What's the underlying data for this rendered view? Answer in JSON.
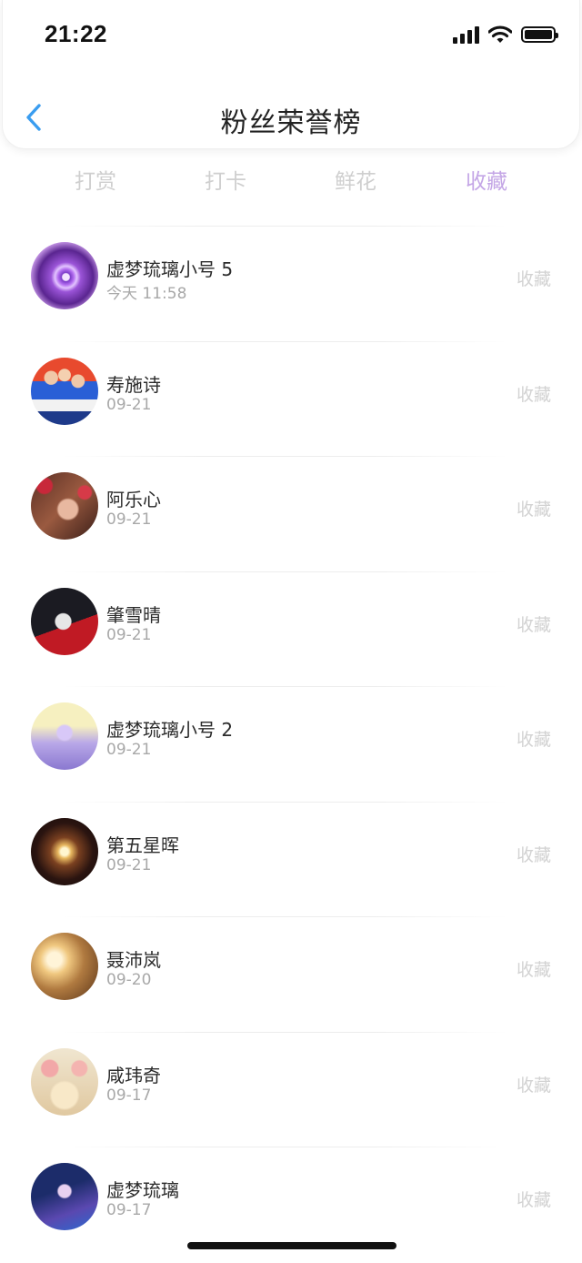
{
  "status": {
    "time": "21:22"
  },
  "header": {
    "title": "粉丝荣誉榜"
  },
  "tabs": [
    {
      "label": "打赏",
      "active": false
    },
    {
      "label": "打卡",
      "active": false
    },
    {
      "label": "鲜花",
      "active": false
    },
    {
      "label": "收藏",
      "active": true
    }
  ],
  "list": [
    {
      "name": "虚梦琉璃小号 5",
      "time": "今天 11:58",
      "action": "收藏",
      "avatar": "purple-eye"
    },
    {
      "name": "寿施诗",
      "time": "09-21",
      "action": "收藏",
      "avatar": "group-photo"
    },
    {
      "name": "阿乐心",
      "time": "09-21",
      "action": "收藏",
      "avatar": "girl-flowers"
    },
    {
      "name": "肇雪晴",
      "time": "09-21",
      "action": "收藏",
      "avatar": "anime-boy"
    },
    {
      "name": "虚梦琉璃小号 2",
      "time": "09-21",
      "action": "收藏",
      "avatar": "castle"
    },
    {
      "name": "第五星晖",
      "time": "09-21",
      "action": "收藏",
      "avatar": "heart-light"
    },
    {
      "name": "聂沛岚",
      "time": "09-20",
      "action": "收藏",
      "avatar": "golden-portrait"
    },
    {
      "name": "咸玮奇",
      "time": "09-17",
      "action": "收藏",
      "avatar": "flower-cake"
    },
    {
      "name": "虚梦琉璃",
      "time": "09-17",
      "action": "收藏",
      "avatar": "fantasy-girl"
    }
  ],
  "colors": {
    "accent": "#c4a6e6",
    "back_icon": "#3a9df0",
    "inactive_tab": "#cfcfcf"
  }
}
